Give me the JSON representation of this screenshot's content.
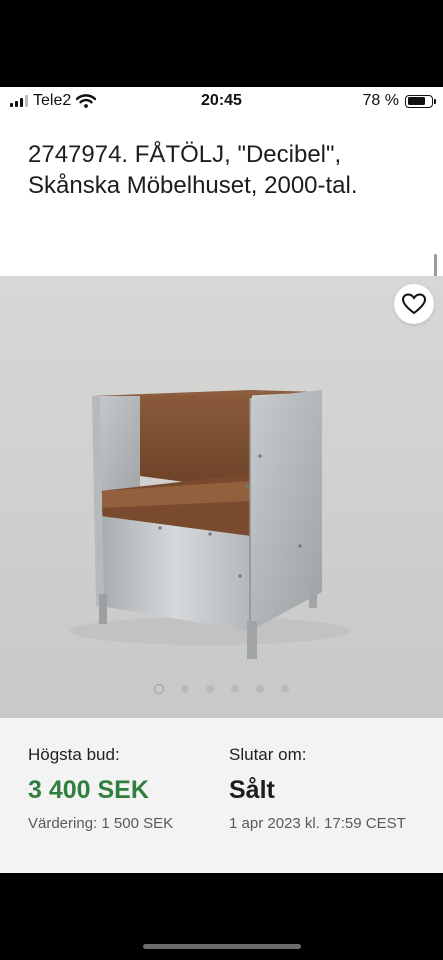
{
  "status_bar": {
    "carrier": "Tele2",
    "time": "20:45",
    "battery_text": "78 %",
    "battery_level": 0.78
  },
  "item": {
    "title": "2747974. FÅTÖLJ, \"Decibel\", Skånska Möbelhuset, 2000-tal."
  },
  "gallery": {
    "image_count": 6,
    "active_index": 0
  },
  "bid": {
    "label": "Högsta bud:",
    "amount": "3 400 SEK",
    "valuation": "Värdering: 1 500 SEK"
  },
  "ends": {
    "label": "Slutar om:",
    "status": "Sålt",
    "date": "1 apr 2023 kl. 17:59 CEST"
  },
  "colors": {
    "price_green": "#317f3f",
    "info_bg": "#f3f3f3"
  },
  "icons": [
    "signal-icon",
    "wifi-icon",
    "battery-icon",
    "heart-icon"
  ]
}
